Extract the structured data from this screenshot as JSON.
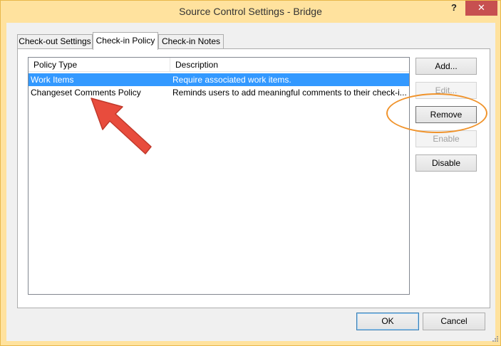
{
  "window": {
    "title": "Source Control Settings - Bridge",
    "help_label": "?",
    "close_label": "✕"
  },
  "tabs": [
    {
      "label": "Check-out Settings",
      "active": false
    },
    {
      "label": "Check-in Policy",
      "active": true
    },
    {
      "label": "Check-in Notes",
      "active": false
    }
  ],
  "policy_list": {
    "columns": [
      "Policy Type",
      "Description"
    ],
    "rows": [
      {
        "type": "Work Items",
        "description": "Require associated work items.",
        "selected": true
      },
      {
        "type": "Changeset Comments Policy",
        "description": "Reminds users to add meaningful comments to their check-i...",
        "selected": false
      }
    ]
  },
  "side_buttons": {
    "add": "Add...",
    "edit": "Edit...",
    "remove": "Remove",
    "enable": "Enable",
    "disable": "Disable"
  },
  "footer": {
    "ok": "OK",
    "cancel": "Cancel"
  },
  "annotations": {
    "arrow_icon": "red-arrow-icon",
    "ellipse_icon": "orange-highlight-ellipse",
    "arrow_color": "#e84c3d",
    "ellipse_color": "#f0932b"
  },
  "colors": {
    "titlebar": "#ffe29e",
    "selection": "#3399ff",
    "close_button": "#c75050"
  }
}
